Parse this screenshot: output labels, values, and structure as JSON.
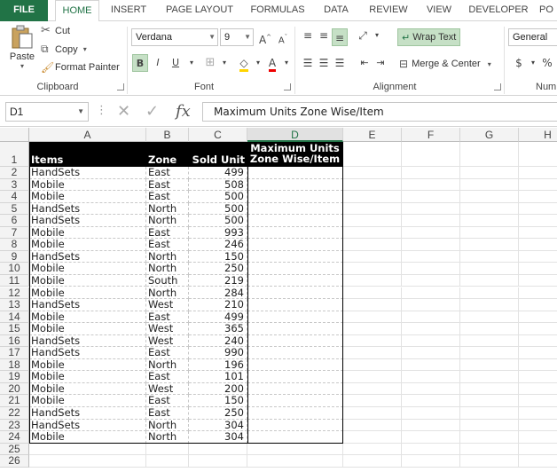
{
  "tabs": [
    "FILE",
    "HOME",
    "INSERT",
    "PAGE LAYOUT",
    "FORMULAS",
    "DATA",
    "REVIEW",
    "VIEW",
    "DEVELOPER",
    "PO"
  ],
  "active_tab": "HOME",
  "ribbon": {
    "clipboard": {
      "paste": "Paste",
      "cut": "Cut",
      "copy": "Copy",
      "format_painter": "Format Painter",
      "label": "Clipboard"
    },
    "font": {
      "name": "Verdana",
      "size": "9",
      "bold": "B",
      "italic": "I",
      "underline": "U",
      "label": "Font"
    },
    "alignment": {
      "wrap_text": "Wrap Text",
      "merge_center": "Merge & Center",
      "label": "Alignment"
    },
    "number": {
      "format": "General",
      "currency": "$",
      "percent": "%",
      "label": "Num"
    }
  },
  "formula_bar": {
    "name_box": "D1",
    "fx": "fx",
    "content": "Maximum Units Zone Wise/Item"
  },
  "columns": [
    "A",
    "B",
    "C",
    "D",
    "E",
    "F",
    "G",
    "H"
  ],
  "selected_column": "D",
  "row_numbers": [
    "1",
    "2",
    "3",
    "4",
    "5",
    "6",
    "7",
    "8",
    "9",
    "10",
    "11",
    "12",
    "13",
    "14",
    "15",
    "16",
    "17",
    "18",
    "19",
    "20",
    "21",
    "22",
    "23",
    "24",
    "25",
    "26"
  ],
  "headers": {
    "items": "Items",
    "zone": "Zone",
    "sold_unit": "Sold Unit",
    "max_line1": "Maximum Units",
    "max_line2": "Zone Wise/Item"
  },
  "rows": [
    [
      "HandSets",
      "East",
      "499"
    ],
    [
      "Mobile",
      "East",
      "508"
    ],
    [
      "Mobile",
      "East",
      "500"
    ],
    [
      "HandSets",
      "North",
      "500"
    ],
    [
      "HandSets",
      "North",
      "500"
    ],
    [
      "Mobile",
      "East",
      "993"
    ],
    [
      "Mobile",
      "East",
      "246"
    ],
    [
      "HandSets",
      "North",
      "150"
    ],
    [
      "Mobile",
      "North",
      "250"
    ],
    [
      "Mobile",
      "South",
      "219"
    ],
    [
      "Mobile",
      "North",
      "284"
    ],
    [
      "HandSets",
      "West",
      "210"
    ],
    [
      "Mobile",
      "East",
      "499"
    ],
    [
      "Mobile",
      "West",
      "365"
    ],
    [
      "HandSets",
      "West",
      "240"
    ],
    [
      "HandSets",
      "East",
      "990"
    ],
    [
      "Mobile",
      "North",
      "196"
    ],
    [
      "Mobile",
      "East",
      "101"
    ],
    [
      "Mobile",
      "West",
      "200"
    ],
    [
      "Mobile",
      "East",
      "150"
    ],
    [
      "HandSets",
      "East",
      "250"
    ],
    [
      "HandSets",
      "North",
      "304"
    ],
    [
      "Mobile",
      "North",
      "304"
    ]
  ]
}
